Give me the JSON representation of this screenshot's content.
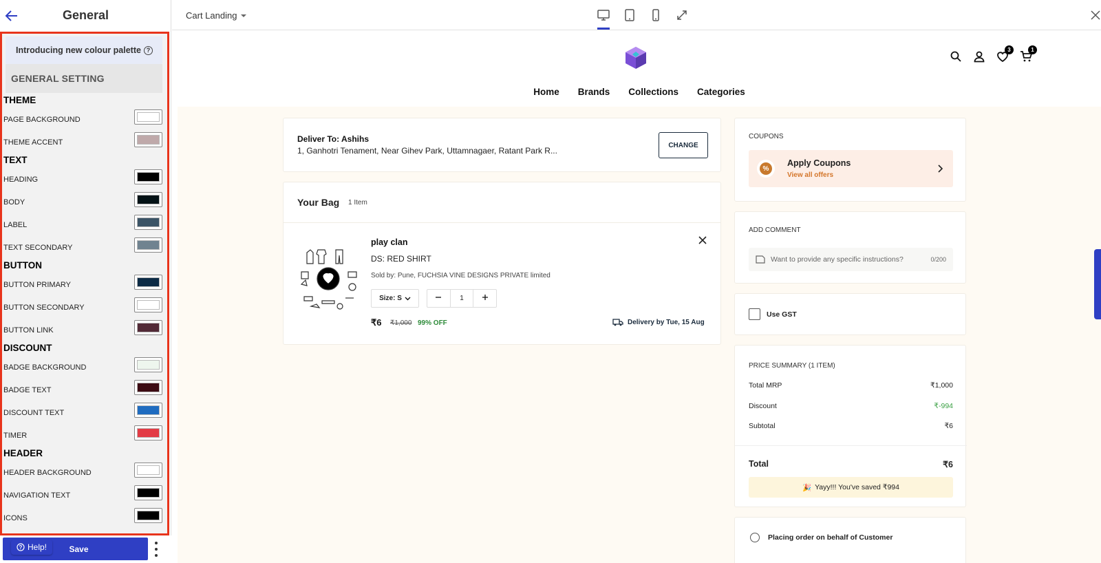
{
  "left_panel": {
    "title": "General",
    "promo_text": "Introducing new colour palette",
    "section_header": "GENERAL SETTING",
    "sections": [
      {
        "title": "THEME",
        "items": [
          {
            "label": "PAGE BACKGROUND",
            "color": "#ffffff"
          },
          {
            "label": "THEME ACCENT",
            "color": "#bfa9aa"
          }
        ]
      },
      {
        "title": "TEXT",
        "items": [
          {
            "label": "HEADING",
            "color": "#000000"
          },
          {
            "label": "BODY",
            "color": "#041216"
          },
          {
            "label": "LABEL",
            "color": "#3b5466"
          },
          {
            "label": "TEXT SECONDARY",
            "color": "#708390"
          }
        ]
      },
      {
        "title": "BUTTON",
        "items": [
          {
            "label": "BUTTON PRIMARY",
            "color": "#0c2b45"
          },
          {
            "label": "BUTTON SECONDARY",
            "color": "#ffffff"
          },
          {
            "label": "BUTTON LINK",
            "color": "#522a37"
          }
        ]
      },
      {
        "title": "DISCOUNT",
        "items": [
          {
            "label": "BADGE BACKGROUND",
            "color": "#eef6ee"
          },
          {
            "label": "BADGE TEXT",
            "color": "#3c0b13"
          },
          {
            "label": "DISCOUNT TEXT",
            "color": "#1f6cc0"
          },
          {
            "label": "TIMER",
            "color": "#e33b45"
          }
        ]
      },
      {
        "title": "HEADER",
        "items": [
          {
            "label": "HEADER BACKGROUND",
            "color": "#ffffff"
          },
          {
            "label": "NAVIGATION TEXT",
            "color": "#000000"
          },
          {
            "label": "ICONS",
            "color": "#000000"
          }
        ]
      }
    ],
    "help_label": "Help!",
    "save_label": "Save"
  },
  "topbar": {
    "page_name": "Cart Landing",
    "devices": [
      "desktop-icon",
      "tablet-icon",
      "mobile-icon",
      "fullscreen-icon"
    ]
  },
  "store": {
    "wishlist_count": "3",
    "cart_count": "1",
    "nav": [
      "Home",
      "Brands",
      "Collections",
      "Categories"
    ]
  },
  "cart": {
    "deliver_title": "Deliver To: Ashihs",
    "deliver_address": "1, Ganhotri Tenament, Near Gihev Park, Uttamnagaer, Ratant Park R...",
    "change_label": "CHANGE",
    "bag_title": "Your Bag",
    "bag_count": "1 Item",
    "item": {
      "name": "play clan",
      "variant": "DS: RED SHIRT",
      "sold_by": "Sold by: Pune, FUCHSIA VINE DESIGNS PRIVATE limited",
      "size": "Size: S",
      "quantity": "1",
      "price": "₹6",
      "mrp": "₹1,000",
      "off": "99% OFF",
      "delivery": "Delivery by Tue, 15 Aug"
    }
  },
  "sidebar": {
    "coupons_title": "COUPONS",
    "apply_coupons": "Apply Coupons",
    "view_offers": "View all offers",
    "comment_title": "ADD COMMENT",
    "comment_placeholder": "Want to provide any specific instructions?",
    "comment_count": "0/200",
    "gst_label": "Use GST",
    "summary_title": "PRICE SUMMARY (1 ITEM)",
    "summary_rows": [
      {
        "label": "Total MRP",
        "value": "₹1,000"
      },
      {
        "label": "Discount",
        "value": "₹-994"
      },
      {
        "label": "Subtotal",
        "value": "₹6"
      }
    ],
    "total_label": "Total",
    "total_value": "₹6",
    "saved_text": "Yayy!!! You've saved ₹994",
    "behalf_label": "Placing order on behalf of Customer"
  }
}
